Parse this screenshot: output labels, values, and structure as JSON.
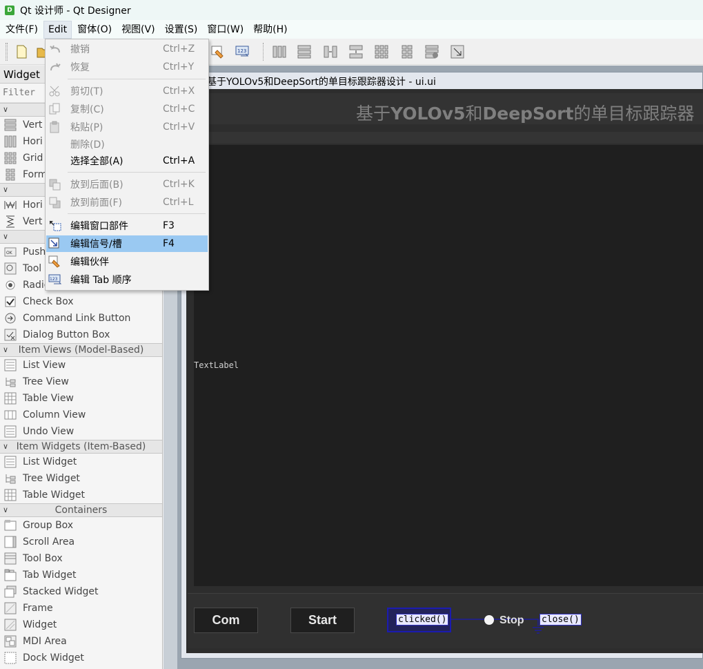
{
  "window": {
    "title": "Qt 设计师 - Qt Designer",
    "app_icon_letter": "D"
  },
  "menubar": {
    "items": [
      "文件(F)",
      "Edit",
      "窗体(O)",
      "视图(V)",
      "设置(S)",
      "窗口(W)",
      "帮助(H)"
    ]
  },
  "widget_box": {
    "title": "Widget",
    "filter_placeholder": "Filter",
    "layouts": [
      "Vert",
      "Hori",
      "Grid",
      "Form"
    ],
    "spacers": [
      "Hori",
      "Vert"
    ],
    "buttons": [
      "Push",
      "Tool",
      "Radio Button",
      "Check Box",
      "Command Link Button",
      "Dialog Button Box"
    ],
    "item_views_header": "Item Views (Model-Based)",
    "item_views": [
      "List View",
      "Tree View",
      "Table View",
      "Column View",
      "Undo View"
    ],
    "item_widgets_header": "Item Widgets (Item-Based)",
    "item_widgets": [
      "List Widget",
      "Tree Widget",
      "Table Widget"
    ],
    "containers_header": "Containers",
    "containers": [
      "Group Box",
      "Scroll Area",
      "Tool Box",
      "Tab Widget",
      "Stacked Widget",
      "Frame",
      "Widget",
      "MDI Area",
      "Dock Widget"
    ]
  },
  "edit_menu": {
    "items": [
      {
        "label": "撤销",
        "shortcut": "Ctrl+Z"
      },
      {
        "label": "恢复",
        "shortcut": "Ctrl+Y"
      },
      {
        "label": "剪切(T)",
        "shortcut": "Ctrl+X"
      },
      {
        "label": "复制(C)",
        "shortcut": "Ctrl+C"
      },
      {
        "label": "粘贴(P)",
        "shortcut": "Ctrl+V"
      },
      {
        "label": "删除(D)",
        "shortcut": ""
      },
      {
        "label": "选择全部(A)",
        "shortcut": "Ctrl+A"
      },
      {
        "label": "放到后面(B)",
        "shortcut": "Ctrl+K"
      },
      {
        "label": "放到前面(F)",
        "shortcut": "Ctrl+L"
      },
      {
        "label": "编辑窗口部件",
        "shortcut": "F3"
      },
      {
        "label": "编辑信号/槽",
        "shortcut": "F4"
      },
      {
        "label": "编辑伙伴",
        "shortcut": ""
      },
      {
        "label": "编辑 Tab 顺序",
        "shortcut": ""
      }
    ]
  },
  "form": {
    "window_title": "基于YOLOv5和DeepSort的单目标跟踪器设计 - ui.ui",
    "heading": {
      "p1": "基于",
      "p2": "YOLOv5",
      "p3": "和",
      "p4": "DeepSort",
      "p5": "的单目标跟踪器"
    },
    "text_label": "TextLabel",
    "buttons": {
      "com": "Com",
      "start": "Start",
      "stop": "Stop"
    },
    "connection": {
      "signal": "clicked()",
      "slot": "close()"
    }
  },
  "colors": {
    "menu_highlight": "#9ac9f2",
    "connection": "#1b1bb0",
    "form_bg": "#2d2d2d"
  }
}
